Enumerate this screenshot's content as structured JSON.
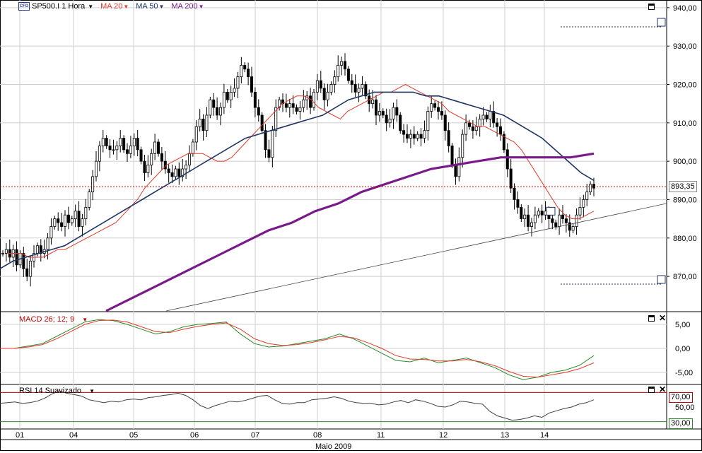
{
  "header": {
    "symbol_logo": "CFD",
    "symbol": "SP500.I 1 Hora",
    "ma20": "MA 20",
    "ma50": "MA 50",
    "ma200": "MA 200"
  },
  "colors": {
    "candle_up": "#ffffff",
    "candle_down": "#000000",
    "ma20": "#e03a2a",
    "ma50": "#1f3564",
    "ma200": "#7a1a8a",
    "current_price_line": "#c00000",
    "macd": "#2a8a2a",
    "macd_signal": "#e03a2a",
    "rsi": "#404040",
    "rsi_upper": "#c00000",
    "rsi_lower": "#2a8a2a",
    "grid": "#cfcfcf"
  },
  "price_axis": {
    "ticks": [
      "940,00",
      "930,00",
      "920,00",
      "910,00",
      "900,00",
      "890,00",
      "880,00",
      "870,00"
    ],
    "current_price": "893,35"
  },
  "macd_panel": {
    "label": "MACD 26; 12; 9",
    "ticks": [
      "5,00",
      "0,00",
      "-5,00"
    ]
  },
  "rsi_panel": {
    "label": "RSI 14 Suavizado",
    "ticks": [
      "70,00",
      "50,00",
      "30,00"
    ]
  },
  "time_axis": {
    "ticks": [
      "01",
      "04",
      "05",
      "06",
      "07",
      "08",
      "11",
      "12",
      "13",
      "14"
    ],
    "month": "Maio 2009"
  },
  "chart_data": [
    {
      "type": "line",
      "title": "SP500.I 1 Hora",
      "x_unit": "hourly bars, May 2009",
      "ylim": [
        861,
        942
      ],
      "ohlc_close_approx": [
        876,
        877,
        875,
        877,
        873,
        876,
        872,
        870,
        874,
        876,
        878,
        876,
        877,
        880,
        883,
        885,
        884,
        883,
        886,
        884,
        885,
        887,
        883,
        885,
        888,
        892,
        896,
        900,
        904,
        906,
        904,
        903,
        903,
        904,
        906,
        903,
        902,
        904,
        906,
        903,
        900,
        897,
        899,
        902,
        905,
        902,
        900,
        898,
        897,
        896,
        898,
        896,
        898,
        899,
        902,
        905,
        909,
        911,
        908,
        912,
        916,
        914,
        912,
        914,
        918,
        916,
        918,
        919,
        922,
        925,
        924,
        922,
        918,
        914,
        912,
        908,
        903,
        901,
        908,
        914,
        916,
        915,
        914,
        915,
        914,
        913,
        914,
        916,
        917,
        914,
        918,
        921,
        919,
        916,
        918,
        920,
        922,
        925,
        926,
        924,
        921,
        920,
        918,
        919,
        920,
        917,
        915,
        916,
        912,
        913,
        912,
        910,
        911,
        914,
        912,
        908,
        907,
        906,
        907,
        906,
        907,
        906,
        908,
        913,
        915,
        914,
        913,
        912,
        908,
        904,
        899,
        896,
        901,
        907,
        910,
        909,
        908,
        909,
        911,
        912,
        911,
        913,
        910,
        909,
        907,
        903,
        898,
        893,
        890,
        888,
        885,
        886,
        883,
        884,
        886,
        887,
        886,
        887,
        885,
        884,
        883,
        886,
        885,
        884,
        882,
        883,
        886,
        888,
        890,
        892,
        894,
        893
      ],
      "series": [
        {
          "name": "MA 20",
          "values": [
            876,
            876,
            876,
            875,
            875,
            875,
            876,
            877,
            877,
            878,
            879,
            880,
            881,
            882,
            883,
            884,
            886,
            888,
            890,
            893,
            895,
            897,
            899,
            900,
            901,
            902,
            902,
            902,
            901,
            900,
            900,
            901,
            903,
            905,
            907,
            909,
            911,
            913,
            915,
            916,
            917,
            917,
            916,
            914,
            913,
            912,
            911,
            913,
            914,
            915,
            916,
            917,
            918,
            918,
            919,
            920,
            919,
            918,
            917,
            916,
            915,
            913,
            912,
            911,
            910,
            909,
            909,
            908,
            907,
            906,
            905,
            903,
            900,
            897,
            894,
            891,
            888,
            886,
            885,
            885,
            886,
            887
          ]
        },
        {
          "name": "MA 50",
          "values": [
            872,
            874,
            875,
            876,
            877,
            878,
            880,
            882,
            884,
            886,
            888,
            890,
            892,
            894,
            896,
            898,
            900,
            902,
            904,
            906,
            907,
            908,
            909,
            910,
            911,
            912,
            914,
            916,
            917,
            918,
            918,
            918,
            918,
            917,
            917,
            916,
            915,
            914,
            913,
            912,
            910,
            908,
            906,
            903,
            900,
            897,
            895
          ]
        },
        {
          "name": "MA 200",
          "values": [
            861,
            864,
            867,
            870,
            873,
            876,
            879,
            882,
            884,
            887,
            889,
            892,
            894,
            896,
            898,
            899,
            900,
            901,
            901,
            901,
            901,
            902
          ]
        }
      ],
      "current_price": 893.35,
      "trendline": {
        "from": 861,
        "to": 889
      }
    },
    {
      "type": "line",
      "title": "MACD 26; 12; 9",
      "ylim": [
        -7.5,
        7.5
      ],
      "series": [
        {
          "name": "MACD",
          "values": [
            0,
            0,
            0.5,
            1,
            2.5,
            4,
            5.5,
            6,
            5.8,
            5,
            4,
            3,
            3.5,
            4.5,
            5,
            5.2,
            5.5,
            3,
            1,
            0.3,
            0.5,
            1,
            1.5,
            2,
            3,
            2,
            0.5,
            -1,
            -2.5,
            -2.8,
            -2,
            -3,
            -2.5,
            -2,
            -3,
            -4,
            -5.5,
            -6.5,
            -6,
            -5,
            -4.5,
            -3.5,
            -1.5
          ]
        },
        {
          "name": "Signal",
          "values": [
            0,
            0,
            0.3,
            0.8,
            2,
            3.5,
            5,
            5.8,
            5.9,
            5.5,
            4.5,
            3.5,
            3.3,
            4,
            4.6,
            5,
            5.3,
            4,
            2,
            1,
            0.6,
            0.8,
            1.2,
            1.8,
            2.5,
            2.2,
            1.2,
            0,
            -1.5,
            -2.2,
            -2.3,
            -2.6,
            -2.6,
            -2.3,
            -2.8,
            -3.6,
            -4.8,
            -5.8,
            -6,
            -5.5,
            -5,
            -4.2,
            -3
          ]
        }
      ]
    },
    {
      "type": "line",
      "title": "RSI 14 Suavizado",
      "ylim": [
        20,
        80
      ],
      "upper_level": 70,
      "lower_level": 30,
      "series": [
        {
          "name": "RSI",
          "values": [
            55,
            56,
            57,
            55,
            56,
            58,
            62,
            68,
            72,
            69,
            67,
            65,
            60,
            58,
            56,
            58,
            57,
            60,
            61,
            60,
            63,
            64,
            66,
            67,
            69,
            66,
            60,
            52,
            48,
            52,
            55,
            58,
            57,
            59,
            62,
            65,
            66,
            60,
            55,
            54,
            56,
            56,
            60,
            61,
            62,
            64,
            62,
            58,
            56,
            55,
            55,
            53,
            54,
            57,
            59,
            56,
            60,
            58,
            55,
            51,
            50,
            53,
            58,
            57,
            55,
            54,
            44,
            38,
            35,
            32,
            33,
            35,
            38,
            36,
            42,
            45,
            48,
            50,
            54,
            56,
            60
          ]
        }
      ]
    }
  ]
}
